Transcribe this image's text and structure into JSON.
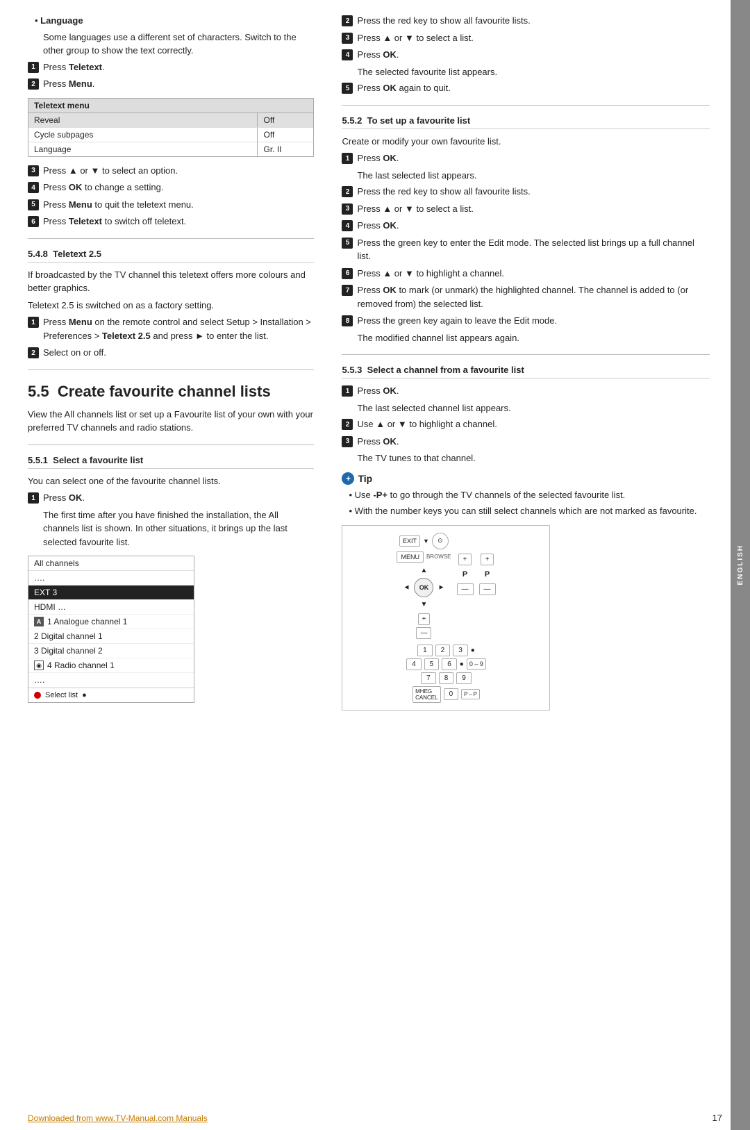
{
  "page": {
    "number": "17",
    "side_tab": "ENGLISH",
    "footer_link": "Downloaded from www.TV-Manual.com Manuals"
  },
  "left_col": {
    "language_section": {
      "title": "Language",
      "para1": "Some languages use a different set of characters. Switch to the other group to show the text correctly.",
      "steps": [
        {
          "num": "1",
          "text": "Press ",
          "bold": "Teletext",
          "after": "."
        },
        {
          "num": "2",
          "text": "Press ",
          "bold": "Menu",
          "after": "."
        }
      ],
      "table": {
        "header": "Teletext menu",
        "rows": [
          {
            "left": "Reveal",
            "right": "Off",
            "highlight": true
          },
          {
            "left": "Cycle subpages",
            "right": "Off",
            "highlight": false
          },
          {
            "left": "Language",
            "right": "Gr. II",
            "highlight": false
          }
        ]
      },
      "steps2": [
        {
          "num": "3",
          "text": "Press ▲ or ▼ to select an option."
        },
        {
          "num": "4",
          "text": "Press ",
          "bold": "OK",
          "after": " to change a setting."
        },
        {
          "num": "5",
          "text": "Press ",
          "bold": "Menu",
          "after": " to quit the teletext menu."
        },
        {
          "num": "6",
          "text": "Press ",
          "bold": "Teletext",
          "after": " to switch off teletext."
        }
      ]
    },
    "teletext_section": {
      "number": "5.4.8",
      "title": "Teletext 2.5",
      "para1": "If broadcasted by the TV channel this teletext offers more colours and better graphics.",
      "para2": "Teletext 2.5 is switched on as a factory setting.",
      "steps": [
        {
          "num": "1",
          "text": "Press ",
          "bold": "Menu",
          "after": " on the remote control and select Setup > Installation > Preferences > ",
          "bold2": "Teletext 2.5",
          "after2": " and press ► to enter the list."
        },
        {
          "num": "2",
          "text": "Select on or off."
        }
      ]
    },
    "section55": {
      "number": "5.5",
      "title": "Create favourite channel lists",
      "para1": "View the All channels list or set up a Favourite list of your own with your preferred TV channels and radio stations."
    },
    "section551": {
      "number": "5.5.1",
      "title": "Select a favourite list",
      "para1": "You can select one of the favourite channel lists.",
      "step1": {
        "num": "1",
        "text": "Press ",
        "bold": "OK",
        "after": "."
      },
      "step1_sub": "The first time after you have finished the installation, the All channels list is shown. In other situations, it brings up the last selected favourite list.",
      "channel_list": {
        "header": "All channels",
        "items": [
          {
            "text": "....",
            "icon": "",
            "selected": false
          },
          {
            "text": "EXT 3",
            "icon": "",
            "selected": true
          },
          {
            "text": "HDMI ...",
            "icon": "",
            "selected": false
          },
          {
            "text": "1 Analogue channel 1",
            "icon": "A",
            "selected": false
          },
          {
            "text": "2 Digital channel 1",
            "icon": "",
            "selected": false
          },
          {
            "text": "3 Digital channel 2",
            "icon": "",
            "selected": false
          },
          {
            "text": "4 Radio channel 1",
            "icon": "radio",
            "selected": false
          },
          {
            "text": "....",
            "icon": "",
            "selected": false
          }
        ],
        "footer": "Select list"
      }
    }
  },
  "right_col": {
    "step_r1": {
      "num": "2",
      "text": "Press the red key to show all favourite lists."
    },
    "step_r2": {
      "num": "3",
      "text": "Press ▲ or ▼ to select a list."
    },
    "step_r3": {
      "num": "4",
      "text": "Press ",
      "bold": "OK",
      "after": "."
    },
    "step_r3_sub": "The selected favourite list appears.",
    "step_r4": {
      "num": "5",
      "text": "Press ",
      "bold": "OK",
      "after": " again to quit."
    },
    "section552": {
      "number": "5.5.2",
      "title": "To set up a favourite list",
      "para1": "Create or modify your own favourite list.",
      "steps": [
        {
          "num": "1",
          "text": "Press ",
          "bold": "OK",
          "after": "."
        },
        {
          "num": "1_sub",
          "text": "The last selected list appears."
        },
        {
          "num": "2",
          "text": "Press the red key to show all favourite lists."
        },
        {
          "num": "3",
          "text": "Press ▲ or ▼ to select a list."
        },
        {
          "num": "4",
          "text": "Press ",
          "bold": "OK",
          "after": "."
        },
        {
          "num": "5",
          "text": "Press the green key to enter the Edit mode. The selected list brings up a full channel list."
        },
        {
          "num": "6",
          "text": "Press ▲ or ▼ to highlight a channel."
        },
        {
          "num": "7",
          "text": "Press ",
          "bold": "OK",
          "after": " to mark (or unmark) the highlighted channel. The channel is added to (or removed from) the selected list."
        },
        {
          "num": "8",
          "text": "Press the green key again to leave the Edit mode."
        },
        {
          "num": "8_sub",
          "text": "The modified channel list appears again."
        }
      ]
    },
    "section553": {
      "number": "5.5.3",
      "title": "Select a channel from a favourite list",
      "steps": [
        {
          "num": "1",
          "text": "Press ",
          "bold": "OK",
          "after": "."
        },
        {
          "num": "1_sub",
          "text": "The last selected channel list appears."
        },
        {
          "num": "2",
          "text": "Use ▲ or ▼ to highlight a channel."
        },
        {
          "num": "3",
          "text": "Press ",
          "bold": "OK",
          "after": "."
        },
        {
          "num": "3_sub",
          "text": "The TV tunes to that channel."
        }
      ]
    },
    "tip": {
      "title": "Tip",
      "bullets": [
        "Use -P+ to go through the TV channels of the selected favourite list.",
        "With the number keys you can still select channels which are not marked as favourite."
      ]
    },
    "remote": {
      "rows": [
        [
          "EXIT",
          "▼",
          "OPTION"
        ],
        [
          "MENU",
          "",
          ""
        ],
        [
          "BROWSE",
          "",
          ""
        ],
        [
          "+",
          "+",
          "+"
        ],
        [
          "◄",
          "OK",
          "P",
          "P"
        ],
        [
          "—",
          "—"
        ],
        [
          "1",
          "2",
          "3"
        ],
        [
          "4",
          "5",
          "6",
          "0–9"
        ],
        [
          "7",
          "8",
          "9"
        ],
        [
          "MHEG CANCEL",
          "0",
          "P⇔P"
        ]
      ]
    }
  }
}
